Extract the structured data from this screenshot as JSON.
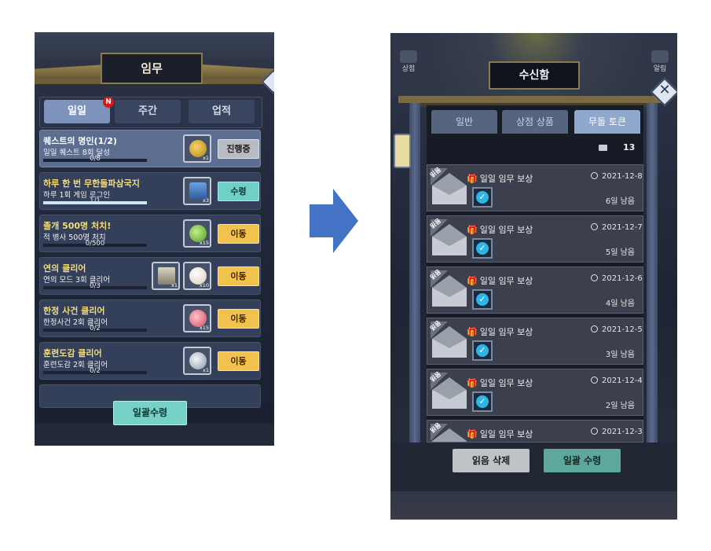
{
  "quest_panel": {
    "title": "임무",
    "tabs": [
      {
        "label": "일일",
        "active": true,
        "badge": "N"
      },
      {
        "label": "주간",
        "active": false
      },
      {
        "label": "업적",
        "active": false
      }
    ],
    "quests": [
      {
        "title": "퀘스트의 명인(1/2)",
        "desc": "일일 퀘스트 8회 달성",
        "progress": "0/8",
        "progress_fraction": 0,
        "items": [
          {
            "icon": "key-icon",
            "count": "x1"
          }
        ],
        "button": "진행중",
        "button_style": "gray",
        "highlight": true
      },
      {
        "title": "하루 한 번 무한돌파삼국지",
        "desc": "하루 1회 게임 로그인",
        "progress": "1/1",
        "progress_fraction": 1,
        "items": [
          {
            "icon": "ticket-pack-icon",
            "count": "x3"
          }
        ],
        "button": "수령",
        "button_style": "teal",
        "highlight": false
      },
      {
        "title": "졸개 500명 처치!",
        "desc": "적 병사 500명 처치",
        "progress": "0/500",
        "progress_fraction": 0,
        "items": [
          {
            "icon": "green-gem-icon",
            "count": "x15"
          }
        ],
        "button": "이동",
        "button_style": "yellow",
        "highlight": false
      },
      {
        "title": "연의 클리어",
        "desc": "연의 모드 3회 클리어",
        "progress": "0/3",
        "progress_fraction": 0,
        "items": [
          {
            "icon": "card-icon",
            "count": "x1"
          },
          {
            "icon": "bun-icon",
            "count": "x10"
          }
        ],
        "button": "이동",
        "button_style": "yellow",
        "highlight": false
      },
      {
        "title": "한정 사건 클리어",
        "desc": "한정사건 2회 클리어",
        "progress": "0/2",
        "progress_fraction": 0,
        "items": [
          {
            "icon": "pink-gem-icon",
            "count": "x15"
          }
        ],
        "button": "이동",
        "button_style": "yellow",
        "highlight": false
      },
      {
        "title": "훈련도감 클리어",
        "desc": "훈련도감 2회 클리어",
        "progress": "0/2",
        "progress_fraction": 0,
        "items": [
          {
            "icon": "key-icon",
            "count": "x1"
          }
        ],
        "button": "이동",
        "button_style": "yellow",
        "highlight": false
      }
    ],
    "claim_all": "일괄수령"
  },
  "mailbox_panel": {
    "title": "수신함",
    "side_labels": [
      "상점",
      "알림"
    ],
    "tabs": [
      {
        "label": "일반",
        "active": false
      },
      {
        "label": "상점 상품",
        "active": false
      },
      {
        "label": "무돌 토큰",
        "active": true
      }
    ],
    "mail_count": "13",
    "read_tag": "읽음",
    "mails": [
      {
        "title": "일일 임무 보상",
        "date": "2021-12-8",
        "remaining": "6일 남음"
      },
      {
        "title": "일일 임무 보상",
        "date": "2021-12-7",
        "remaining": "5일 남음"
      },
      {
        "title": "일일 임무 보상",
        "date": "2021-12-6",
        "remaining": "4일 남음"
      },
      {
        "title": "일일 임무 보상",
        "date": "2021-12-5",
        "remaining": "3일 남음"
      },
      {
        "title": "일일 임무 보상",
        "date": "2021-12-4",
        "remaining": "2일 남음"
      },
      {
        "title": "일일 임무 보상",
        "date": "2021-12-3",
        "remaining": ""
      }
    ],
    "delete_read": "읽음 삭제",
    "claim_all": "일괄 수령"
  },
  "colors": {
    "arrow": "#4472c4",
    "claim_teal": "#76d2c8",
    "move_yellow": "#f2c24e"
  }
}
